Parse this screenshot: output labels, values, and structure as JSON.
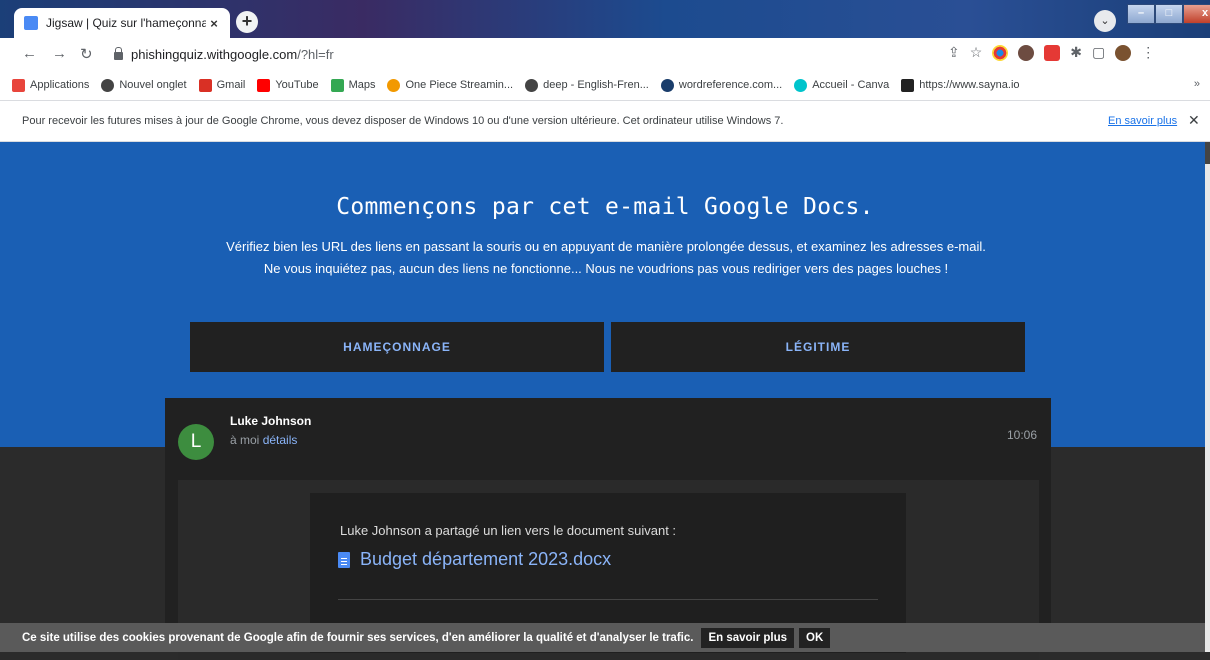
{
  "browser": {
    "tab_title": "Jigsaw | Quiz sur l'hameçonnage",
    "tab_close": "×",
    "new_tab": "+",
    "url_host": "phishingquiz.withgoogle.com",
    "url_path": "/?hl=fr",
    "bookmarks": [
      {
        "label": "Applications",
        "color": "#e8453c"
      },
      {
        "label": "Nouvel onglet",
        "color": "#444444"
      },
      {
        "label": "Gmail",
        "color": "#d93025"
      },
      {
        "label": "YouTube",
        "color": "#ff0000"
      },
      {
        "label": "Maps",
        "color": "#34a853"
      },
      {
        "label": "One Piece Streamin...",
        "color": "#f29900"
      },
      {
        "label": "deep - English-Fren...",
        "color": "#444444"
      },
      {
        "label": "wordreference.com...",
        "color": "#1a3d6b"
      },
      {
        "label": "Accueil - Canva",
        "color": "#00c4cc"
      },
      {
        "label": "https://www.sayna.io",
        "color": "#222222"
      }
    ],
    "bookmarks_more": "»",
    "infobar_message": "Pour recevoir les futures mises à jour de Google Chrome, vous devez disposer de Windows 10 ou d'une version ultérieure. Cet ordinateur utilise Windows 7.",
    "infobar_link": "En savoir plus",
    "infobar_close": "✕"
  },
  "quiz": {
    "title": "Commençons par cet e-mail Google Docs.",
    "instructions": "Vérifiez bien les URL des liens en passant la souris ou en appuyant de manière prolongée dessus, et examinez les adresses e-mail. Ne vous inquiétez pas, aucun des liens ne fonctionne... Nous ne voudrions pas vous rediriger vers des pages louches !",
    "btn_phishing": "HAMEÇONNAGE",
    "btn_legit": "LÉGITIME"
  },
  "email": {
    "avatar_letter": "L",
    "sender": "Luke Johnson",
    "recipient_prefix": "à moi",
    "details_link": "détails",
    "time": "10:06",
    "share_text": "Luke Johnson a partagé un lien vers le document suivant :",
    "doc_name": "Budget département 2023.docx"
  },
  "cookie": {
    "text": "Ce site utilise des cookies provenant de Google afin de fournir ses services, d'en améliorer la qualité et d'analyser le trafic.",
    "learn_more": "En savoir plus",
    "ok": "OK"
  },
  "colors": {
    "hero_blue": "#1a5fb4",
    "link_blue": "#8ab4f8",
    "avatar_green": "#3d8d3f"
  }
}
